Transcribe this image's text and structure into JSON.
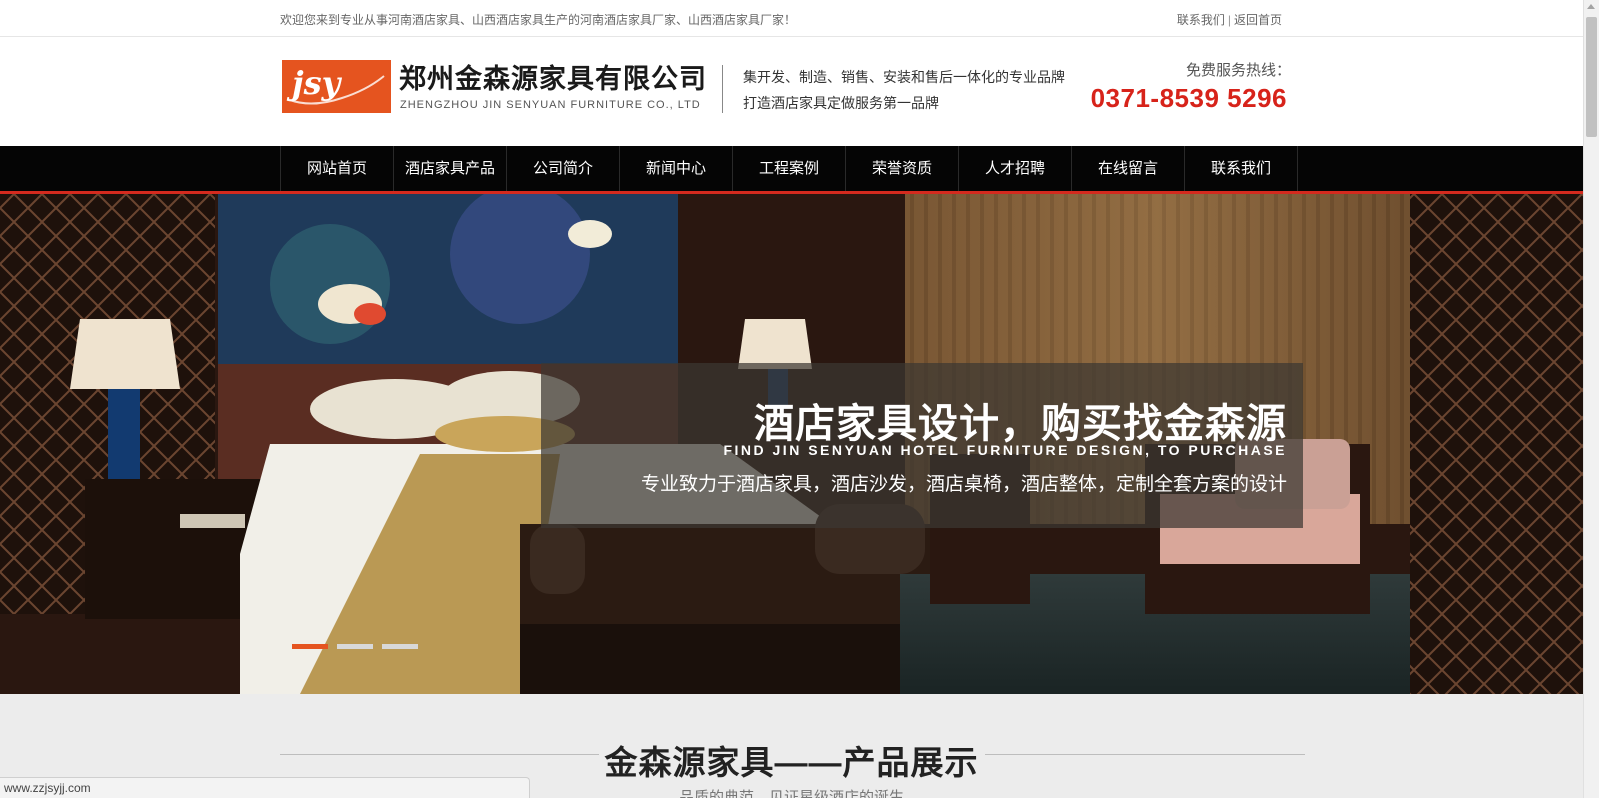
{
  "topbar": {
    "welcome": "欢迎您来到专业从事河南酒店家具、山西酒店家具生产的河南酒店家具厂家、山西酒店家具厂家！",
    "contact_link": "联系我们",
    "separator": "|",
    "home_link": "返回首页"
  },
  "header": {
    "logo_text": "JSY",
    "company_cn": "郑州金森源家具有限公司",
    "company_en": "ZHENGZHOU JIN SENYUAN FURNITURE CO., LTD",
    "slogan1": "集开发、制造、销售、安装和售后一体化的专业品牌",
    "slogan2": "打造酒店家具定做服务第一品牌",
    "hotline_label": "免费服务热线：",
    "hotline_number": "0371-8539 5296"
  },
  "nav": {
    "items": [
      {
        "label": "网站首页"
      },
      {
        "label": "酒店家具产品"
      },
      {
        "label": "公司简介"
      },
      {
        "label": "新闻中心"
      },
      {
        "label": "工程案例"
      },
      {
        "label": "荣誉资质"
      },
      {
        "label": "人才招聘"
      },
      {
        "label": "在线留言"
      },
      {
        "label": "联系我们"
      }
    ]
  },
  "banner": {
    "title": "酒店家具设计，购买找金森源",
    "title_en": "FIND JIN SENYUAN HOTEL FURNITURE DESIGN, TO PURCHASE",
    "subtitle": "专业致力于酒店家具，酒店沙发，酒店桌椅，酒店整体，定制全套方案的设计",
    "slides": 3,
    "active_slide": 1
  },
  "section": {
    "title": "金森源家具——产品展示",
    "subtitle": "品质的典范，见证星级酒店的诞生"
  },
  "statusbar": {
    "url": "www.zzjsyjj.com"
  },
  "colors": {
    "accent_red": "#d7231a",
    "logo_orange": "#e5541f",
    "nav_bg": "#050505"
  }
}
